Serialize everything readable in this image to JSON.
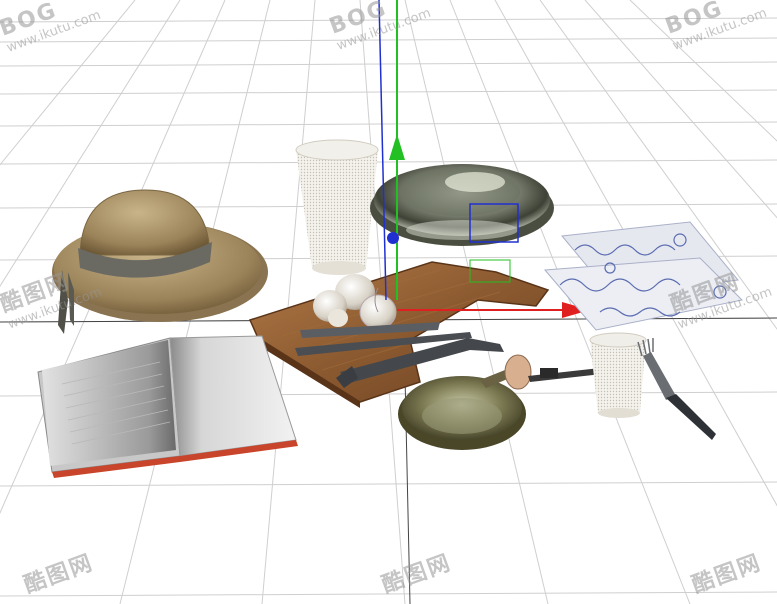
{
  "viewport": {
    "background": "#ffffff",
    "grid_color": "#cfcfcf",
    "axis_colors": {
      "x": "#e02020",
      "y": "#22c022",
      "z": "#2030d0"
    }
  },
  "objects": [
    "sun-hat",
    "open-book",
    "drinking-glass",
    "glass-bowl",
    "cutting-board",
    "garlic-bulbs",
    "knife-and-fork",
    "frying-pan",
    "corkscrew",
    "napkin",
    "small-glass",
    "dinner-fork"
  ],
  "watermark": {
    "mark_text": "酷图网",
    "brand_text": "BOG",
    "url_text": "www.ikutu.com"
  }
}
